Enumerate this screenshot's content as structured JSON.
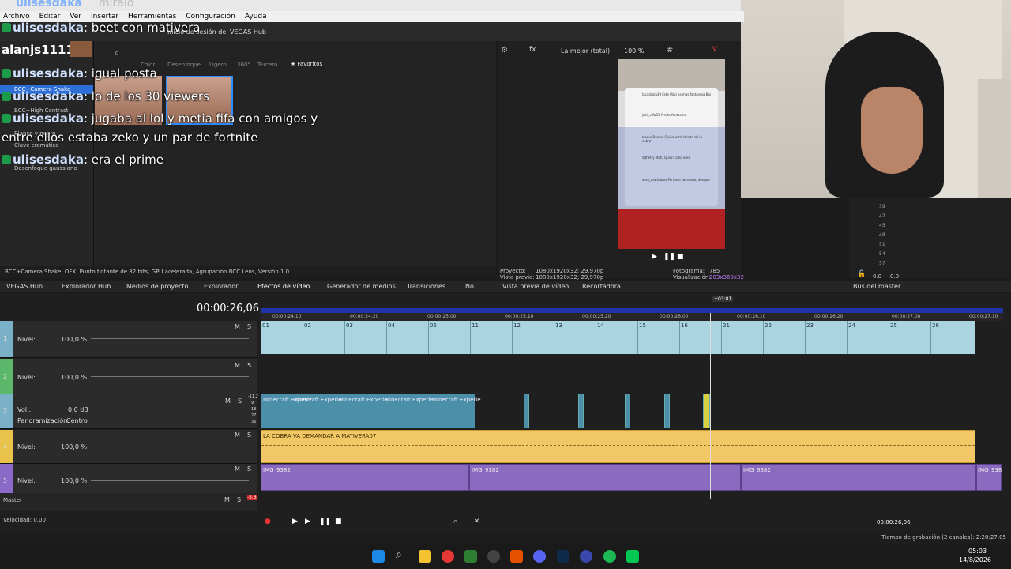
{
  "overlay": {
    "top_text": "ulisesdaka",
    "top_suffix": "miralo"
  },
  "menu": [
    "Archivo",
    "Editar",
    "Ver",
    "Insertar",
    "Herramientas",
    "Configuración",
    "Ayuda"
  ],
  "vegas_hub_login": "Inicio de sesión del VEGAS Hub",
  "chat": [
    {
      "user": "ulisesdaka",
      "message": "beet con mativera"
    },
    {
      "user": "alanjs1111",
      "message": ""
    },
    {
      "user": "ulisesdaka",
      "message": "igual posta"
    },
    {
      "user": "ulisesdaka",
      "message": "lo de los 30 viewers"
    },
    {
      "user": "ulisesdaka",
      "message": "jugaba al lol y metia fifa con amigos y"
    },
    {
      "user": "",
      "message": "entre ellos estaba zeko y un par de fortnite"
    },
    {
      "user": "ulisesdaka",
      "message": "era el prime"
    }
  ],
  "effects_tabs": [
    "Todos los plug-ins",
    "Color",
    "Extra",
    "Desenfoque",
    "Ligero",
    "360°",
    "Tercero",
    "Favoritos"
  ],
  "effects_list": [
    "BCC+Camera Shake",
    "BCC+High Contrast",
    "Blanco y negro",
    "Clave cromática",
    "Desenfoque gaussiano"
  ],
  "effects_status": "BCC+Camera Shake: OFX, Punto flotante de 32 bits, GPU acelerada, Agrupación BCC Lens, Versión 1.0",
  "preview": {
    "quality": "La mejor (total)",
    "zoom": "100 %",
    "proyecto_label": "Proyecto:",
    "proyecto": "1080x1920x32; 29,970p",
    "vista_label": "Vista previa:",
    "vista": "1080x1920x32; 29,970p",
    "foto_label": "Fotograma:",
    "foto": "785",
    "visual_label": "Visualización:",
    "visual": "203x360x32"
  },
  "master_vals": [
    "0.0",
    "0.0"
  ],
  "master_scale": [
    "39",
    "42",
    "45",
    "48",
    "51",
    "54",
    "57"
  ],
  "tabs": [
    "VEGAS Hub",
    "Explorador Hub",
    "Medios de proyecto",
    "Explorador",
    "Efectos de vídeo",
    "Generador de medios",
    "Transiciones",
    "No",
    "Vista previa de vídeo",
    "Recortadora",
    "Bus del master"
  ],
  "timecode": "00:00:26,06",
  "time_marker": "+03:01",
  "ruler": [
    "00:00:24,10",
    "00:00:24,20",
    "00:00:25,00",
    "00:00:25,10",
    "00:00:25,20",
    "00:00:26,00",
    "00:00:26,10",
    "00:00:26,20",
    "00:00:27,00",
    "00:00:27,10"
  ],
  "track1_nums": [
    "01",
    "02",
    "03",
    "04",
    "05",
    "11",
    "12",
    "13",
    "14",
    "15",
    "16",
    "21",
    "22",
    "23",
    "24",
    "25",
    "26"
  ],
  "tracks": [
    {
      "num": "1",
      "label": "Nivel:",
      "value": "100,0 %"
    },
    {
      "num": "2",
      "label": "Nivel:",
      "value": "100,0 %"
    },
    {
      "num": "3",
      "label": "Vol.:",
      "value": "0,0 dB",
      "pan_label": "Panoramización:",
      "pan_value": "Centro"
    },
    {
      "num": "4",
      "label": "Nivel:",
      "value": "100,0 %"
    },
    {
      "num": "5",
      "label": "Nivel:",
      "value": "100,0 %"
    }
  ],
  "track3_meter": [
    "-11,2",
    "9",
    "18",
    "27",
    "36"
  ],
  "mute": "M",
  "solo": "S",
  "audio_clip_label": "Minecraft Experie",
  "yellow_clip_label": "LA COBRA VA DEMANDAR A MATIVERA07",
  "purple_clips": [
    "IMG_9382",
    "IMG_9382",
    "IMG_9382",
    "IMG_938"
  ],
  "master_label": "Master",
  "master_meter": "-5.6",
  "velocidad": "Velocidad: 0,00",
  "transport_time": "00:00:26,06",
  "status_right": "Tiempo de grabación (2 canales): 2:20:27:05",
  "clock": {
    "time": "05:03",
    "date": "14/8/2026"
  },
  "phone_comments": [
    "lucasbola39 Este Mati es más fantasma Boi",
    "jani_villa03 Y este fantasma",
    "IvanvaBarrosi Quién está al lado de la cebra?",
    "djthefry Mati, Quien cono eres",
    "aron_mariobros Porfavor de mario, dengue"
  ]
}
